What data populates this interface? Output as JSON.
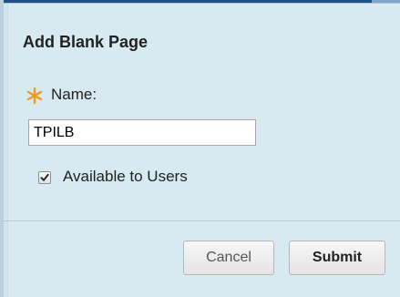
{
  "dialog": {
    "title": "Add Blank Page",
    "name_label": "Name:",
    "name_value": "TPILB",
    "available_label": "Available to Users",
    "available_checked": true,
    "cancel_label": "Cancel",
    "submit_label": "Submit"
  },
  "colors": {
    "required_asterisk": "#f39a1b",
    "background": "#d7eaf1"
  },
  "icons": {
    "required": "asterisk-icon",
    "checkbox": "checkmark-icon"
  }
}
